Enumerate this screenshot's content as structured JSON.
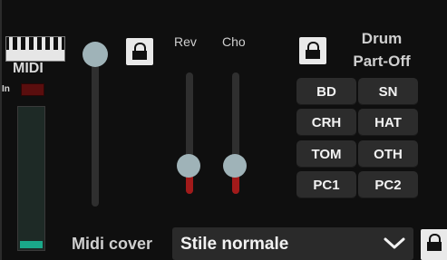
{
  "midi": {
    "label": "MIDI",
    "in_label": "In",
    "meter_level": 0.05
  },
  "effects": {
    "rev": {
      "label": "Rev",
      "value": 0.17
    },
    "cho": {
      "label": "Cho",
      "value": 0.17
    },
    "master_value": 1.0
  },
  "drum": {
    "title_line1": "Drum",
    "title_line2": "Part-Off",
    "buttons": [
      "BD",
      "SN",
      "CRH",
      "HAT",
      "TOM",
      "OTH",
      "PC1",
      "PC2"
    ]
  },
  "midi_cover": {
    "label": "Midi cover",
    "selected": "Stile normale"
  },
  "colors": {
    "knob": "#9fb3b8",
    "track": "#2f2f2f",
    "red": "#a21a1a",
    "meter_fill": "#1aa98a",
    "button_bg": "#2c2c2c",
    "lock_bg": "#e9e9e9"
  },
  "icons": {
    "keyboard": "piano-keyboard-icon",
    "lock": "unlock-icon",
    "chevron": "chevron-down-icon"
  }
}
